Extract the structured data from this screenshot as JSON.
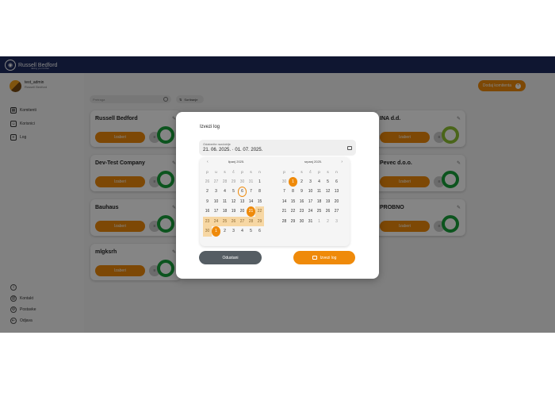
{
  "app": {
    "brand": "Russell Bedford",
    "tagline": "taking you further",
    "brand_color": "#1d2b5f",
    "accent_color": "#ef8a0a"
  },
  "user": {
    "name": "test_admin",
    "org": "Russell Bedford"
  },
  "sidebar": {
    "items": [
      {
        "label": "Komitenti",
        "icon": "building-icon"
      },
      {
        "label": "Korisnici",
        "icon": "users-icon"
      },
      {
        "label": "Log",
        "icon": "list-icon"
      }
    ],
    "bottom_items": [
      {
        "label": "",
        "icon": "info-icon"
      },
      {
        "label": "Kontakt",
        "icon": "contact-icon"
      },
      {
        "label": "Postavke",
        "icon": "gear-icon"
      },
      {
        "label": "Odjava",
        "icon": "logout-icon"
      }
    ]
  },
  "toolbar": {
    "search_placeholder": "Pretraga",
    "sort_label": "Sortiranje",
    "add_client_label": "Dodaj komitenta"
  },
  "cards": [
    {
      "title": "Russell Bedford",
      "button": "Izaberi"
    },
    {
      "title": "Dev-Test Company",
      "button": "Izaberi"
    },
    {
      "title": "Bauhaus",
      "button": "Izaberi"
    },
    {
      "title": "mlgksrh",
      "button": "Izaberi"
    },
    {
      "title": "INA d.d.",
      "button": "Izaberi"
    },
    {
      "title": "Pevec d.o.o.",
      "button": "Izaberi"
    },
    {
      "title": "PROBNO",
      "button": "Izaberi"
    }
  ],
  "modal": {
    "title": "Izvezi log",
    "range_label": "Odaberite razdoblje",
    "range_value": "21. 06. 2025.  ·  01. 07. 2025.",
    "cancel_label": "Odustani",
    "export_label": "Izvezi log",
    "months": [
      {
        "title": "lipanj 2025.",
        "weekdays": [
          "p",
          "u",
          "s",
          "č",
          "p",
          "s",
          "n"
        ],
        "days": [
          "26",
          "27",
          "28",
          "29",
          "30",
          "31",
          "1",
          "2",
          "3",
          "4",
          "5",
          "6",
          "7",
          "8",
          "9",
          "10",
          "11",
          "12",
          "13",
          "14",
          "15",
          "16",
          "17",
          "18",
          "19",
          "20",
          "21",
          "22",
          "23",
          "24",
          "25",
          "26",
          "27",
          "28",
          "29",
          "30",
          "1",
          "2",
          "3",
          "4",
          "5",
          "6"
        ]
      },
      {
        "title": "srpanj 2025.",
        "weekdays": [
          "p",
          "u",
          "s",
          "č",
          "p",
          "s",
          "n"
        ],
        "days": [
          "30",
          "1",
          "2",
          "3",
          "4",
          "5",
          "6",
          "7",
          "8",
          "9",
          "10",
          "11",
          "12",
          "13",
          "14",
          "15",
          "16",
          "17",
          "18",
          "19",
          "20",
          "21",
          "22",
          "23",
          "24",
          "25",
          "26",
          "27",
          "28",
          "29",
          "30",
          "31",
          "1",
          "2",
          "3"
        ]
      }
    ]
  }
}
